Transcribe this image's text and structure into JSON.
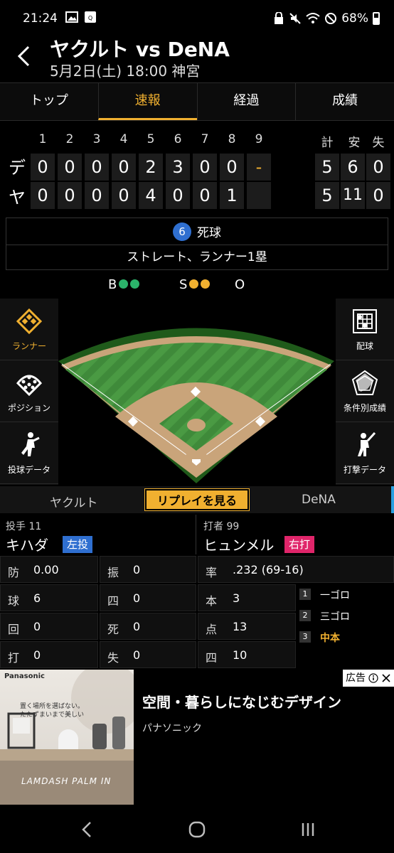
{
  "status_bar": {
    "time": "21:24",
    "battery": "68%"
  },
  "header": {
    "title": "ヤクルト vs DeNA",
    "subtitle": "5月2日(土) 18:00 神宮"
  },
  "tabs": [
    {
      "label": "トップ",
      "active": false
    },
    {
      "label": "速報",
      "active": true
    },
    {
      "label": "経過",
      "active": false
    },
    {
      "label": "成績",
      "active": false
    }
  ],
  "scoreboard": {
    "innings": [
      "1",
      "2",
      "3",
      "4",
      "5",
      "6",
      "7",
      "8",
      "9"
    ],
    "totals_headers": [
      "計",
      "安",
      "失"
    ],
    "teams": [
      {
        "label": "デ",
        "innings": [
          "0",
          "0",
          "0",
          "0",
          "2",
          "3",
          "0",
          "0",
          "-"
        ],
        "totals": [
          "5",
          "6",
          "0"
        ]
      },
      {
        "label": "ヤ",
        "innings": [
          "0",
          "0",
          "0",
          "0",
          "4",
          "0",
          "0",
          "1",
          ""
        ],
        "totals": [
          "5",
          "11",
          "0"
        ]
      }
    ]
  },
  "play": {
    "number": "6",
    "result": "死球",
    "detail": "ストレート、ランナー1塁"
  },
  "count": {
    "b": "B",
    "s": "S",
    "o": "O",
    "ball_color": "#2bb36a",
    "strike_color": "#f0b030"
  },
  "left_menu": [
    {
      "label": "ランナー",
      "icon": "runner-diamond-icon",
      "active": true
    },
    {
      "label": "ポジション",
      "icon": "position-icon",
      "active": false
    },
    {
      "label": "投球データ",
      "icon": "pitcher-icon",
      "active": false
    }
  ],
  "right_menu": [
    {
      "label": "配球",
      "icon": "pitch-grid-icon"
    },
    {
      "label": "条件別成績",
      "icon": "radar-icon"
    },
    {
      "label": "打撃データ",
      "icon": "batter-icon"
    }
  ],
  "team_bar": {
    "left": "ヤクルト",
    "replay": "リプレイを見る",
    "right": "DeNA"
  },
  "pitcher": {
    "role": "投手 11",
    "name": "キハダ",
    "hand": "左投"
  },
  "batter": {
    "role": "打者 99",
    "name": "ヒュンメル",
    "hand": "右打"
  },
  "pitcher_stats": [
    {
      "k": "防",
      "v": "0.00"
    },
    {
      "k": "振",
      "v": "0"
    },
    {
      "k": "球",
      "v": "6"
    },
    {
      "k": "四",
      "v": "0"
    },
    {
      "k": "回",
      "v": "0"
    },
    {
      "k": "死",
      "v": "0"
    },
    {
      "k": "打",
      "v": "0"
    },
    {
      "k": "失",
      "v": "0"
    }
  ],
  "batter_stats": [
    {
      "k": "率",
      "v": ".232 (69-16)"
    },
    {
      "k": "本",
      "v": "3"
    },
    {
      "k": "点",
      "v": "13"
    },
    {
      "k": "四",
      "v": "10"
    }
  ],
  "batting_order": [
    {
      "num": "1",
      "text": "一ゴロ",
      "current": false
    },
    {
      "num": "2",
      "text": "三ゴロ",
      "current": false
    },
    {
      "num": "3",
      "text": "中本",
      "current": true
    }
  ],
  "ad": {
    "badge": "広告",
    "brand": "Panasonic",
    "copy1": "置く場所を選ばない。",
    "copy2": "たたずまいまで美しい",
    "product": "LAMDASH PALM IN",
    "headline": "空間・暮らしになじむデザイン",
    "advertiser": "パナソニック"
  }
}
